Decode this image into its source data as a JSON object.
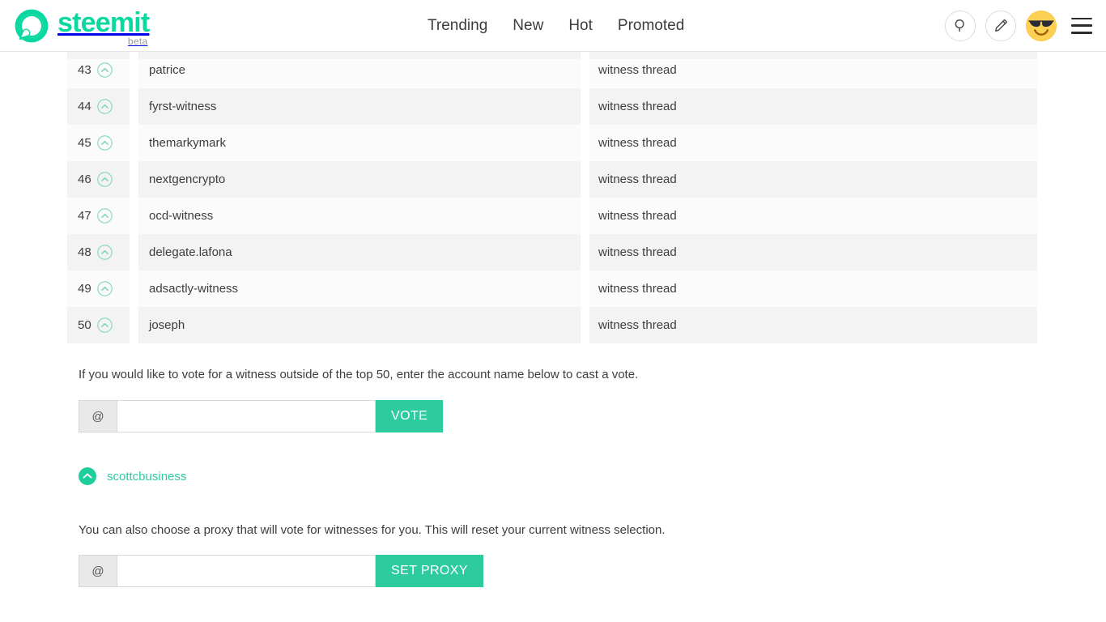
{
  "header": {
    "brand_word": "steemit",
    "brand_beta": "beta",
    "nav": [
      {
        "label": "Trending",
        "name": "nav-trending"
      },
      {
        "label": "New",
        "name": "nav-new"
      },
      {
        "label": "Hot",
        "name": "nav-hot"
      },
      {
        "label": "Promoted",
        "name": "nav-promoted"
      }
    ],
    "icons": {
      "search": "search-icon",
      "compose": "pencil-icon",
      "avatar": "sunglasses-emoji-avatar",
      "menu": "hamburger-menu-icon"
    }
  },
  "colors": {
    "brand_green": "#09d8a0",
    "button_green": "#2ecb9f",
    "upvote_outline": "#7fd8b8",
    "row_alt_bg": "#f3f3f3",
    "row_bg": "#fbfbfb",
    "text": "#3d3d3d"
  },
  "witness_table": {
    "thread_label": "witness thread",
    "rows": [
      {
        "rank": "43",
        "name": "patrice",
        "thread": "witness thread"
      },
      {
        "rank": "44",
        "name": "fyrst-witness",
        "thread": "witness thread"
      },
      {
        "rank": "45",
        "name": "themarkymark",
        "thread": "witness thread"
      },
      {
        "rank": "46",
        "name": "nextgencrypto",
        "thread": "witness thread"
      },
      {
        "rank": "47",
        "name": "ocd-witness",
        "thread": "witness thread"
      },
      {
        "rank": "48",
        "name": "delegate.lafona",
        "thread": "witness thread"
      },
      {
        "rank": "49",
        "name": "adsactly-witness",
        "thread": "witness thread"
      },
      {
        "rank": "50",
        "name": "joseph",
        "thread": "witness thread"
      }
    ]
  },
  "vote_form": {
    "note": "If you would like to vote for a witness outside of the top 50, enter the account name below to cast a vote.",
    "at_prefix": "@",
    "input_value": "",
    "input_placeholder": "",
    "button_label": "VOTE"
  },
  "current_votes": [
    {
      "name": "scottcbusiness",
      "voted": true
    }
  ],
  "proxy_form": {
    "note": "You can also choose a proxy that will vote for witnesses for you. This will reset your current witness selection.",
    "at_prefix": "@",
    "input_value": "",
    "input_placeholder": "",
    "button_label": "SET PROXY"
  }
}
